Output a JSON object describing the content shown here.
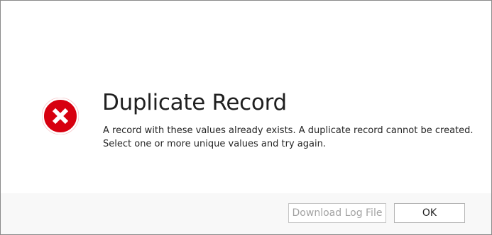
{
  "dialog": {
    "title": "Duplicate Record",
    "message_line1": "A record with these values already exists. A duplicate record cannot be created.",
    "message_line2": "Select one or more unique values and try again.",
    "icon": "error-icon",
    "icon_color": "#d7000f"
  },
  "footer": {
    "download_log_label": "Download Log File",
    "download_log_enabled": false,
    "ok_label": "OK"
  }
}
